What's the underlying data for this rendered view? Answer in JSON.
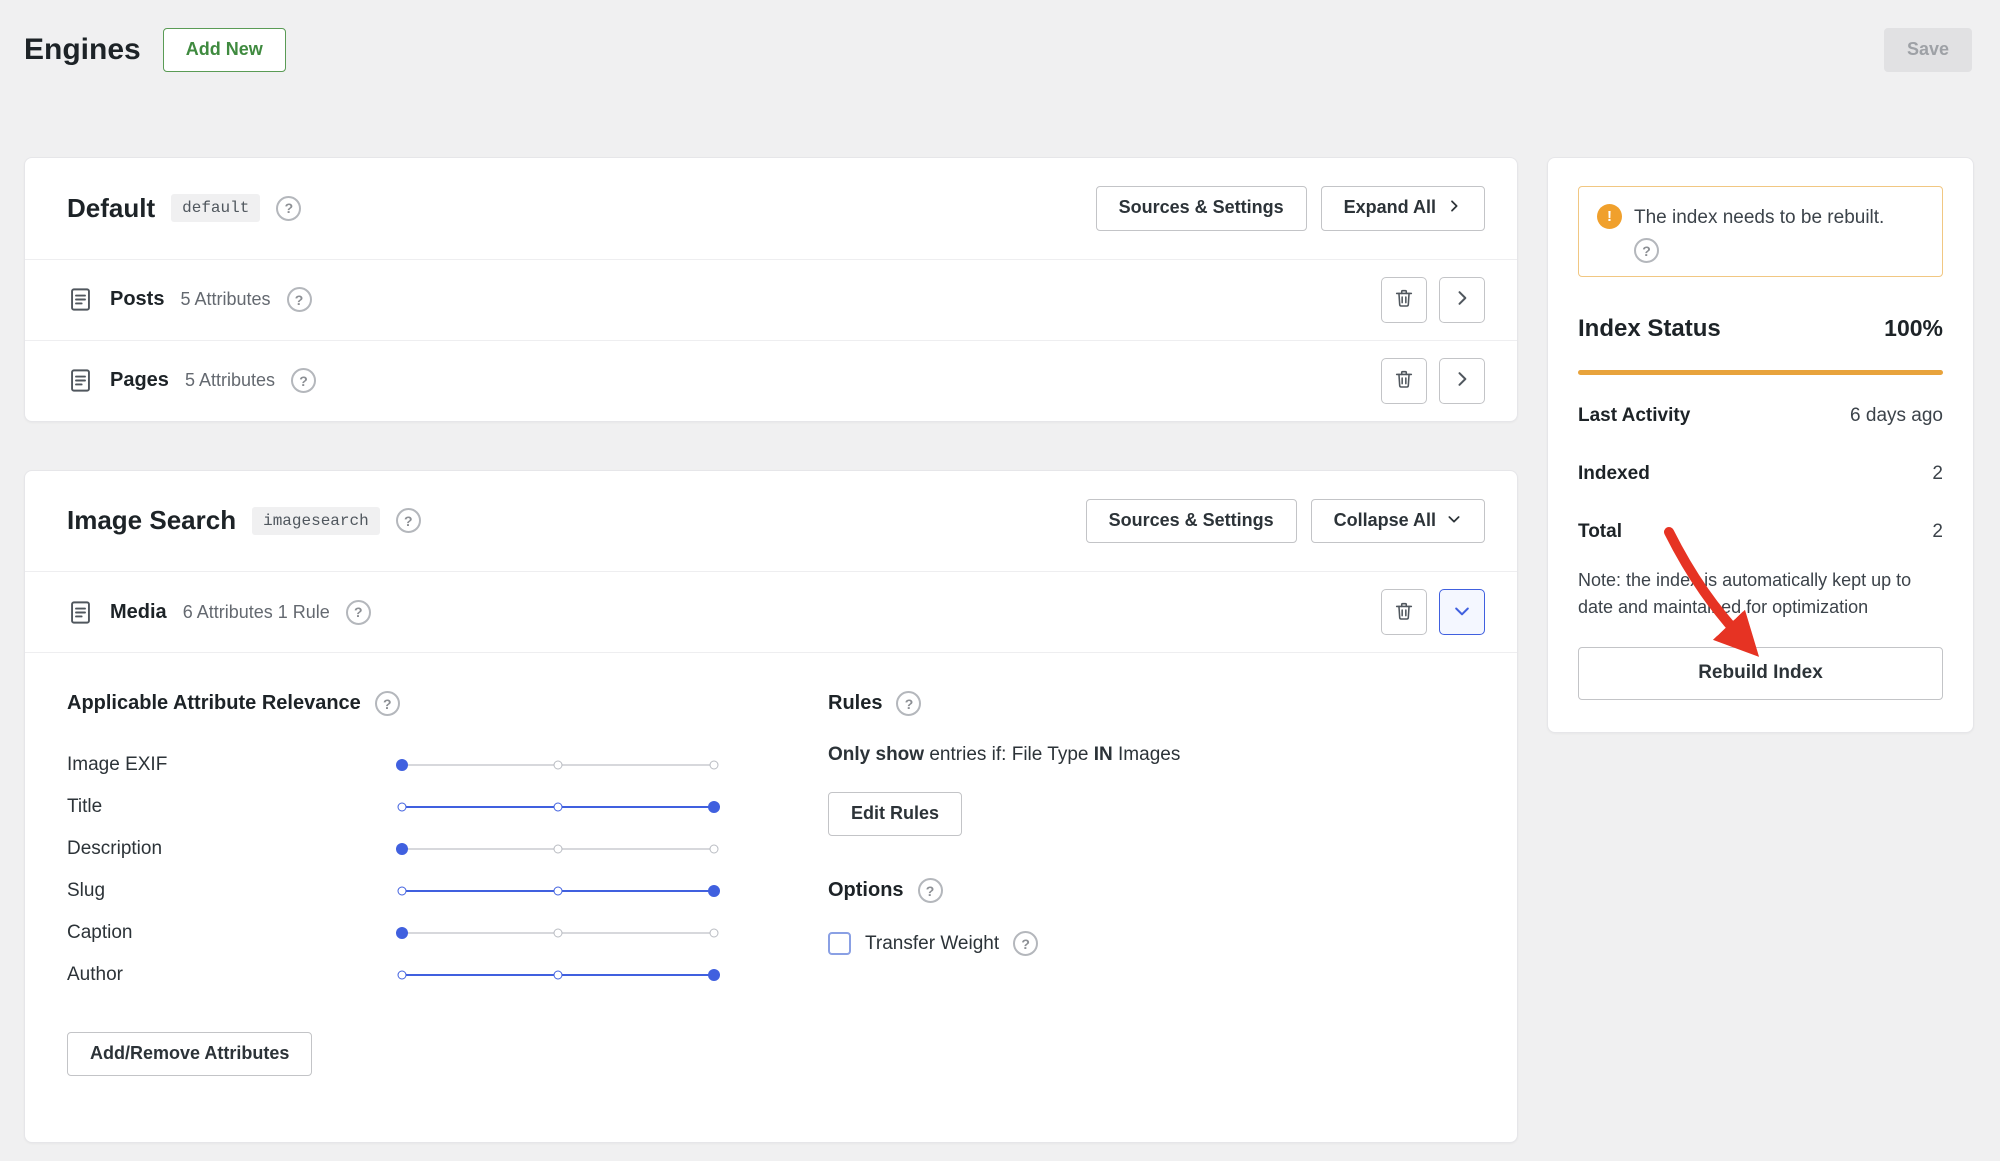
{
  "page": {
    "title": "Engines",
    "add_new_label": "Add New",
    "save_label": "Save"
  },
  "icons": {
    "help": "?",
    "alert": "!"
  },
  "engines": [
    {
      "name": "Default",
      "slug": "default",
      "sources_settings_label": "Sources & Settings",
      "toggle_label": "Expand All",
      "sources": [
        {
          "name": "Posts",
          "meta": "5 Attributes"
        },
        {
          "name": "Pages",
          "meta": "5 Attributes"
        }
      ]
    },
    {
      "name": "Image Search",
      "slug": "imagesearch",
      "sources_settings_label": "Sources & Settings",
      "toggle_label": "Collapse All",
      "sources": [
        {
          "name": "Media",
          "meta": "6 Attributes 1 Rule"
        }
      ],
      "expanded": {
        "relevance_title": "Applicable Attribute Relevance",
        "attributes": [
          {
            "label": "Image EXIF",
            "value": 0
          },
          {
            "label": "Title",
            "value": 100
          },
          {
            "label": "Description",
            "value": 0
          },
          {
            "label": "Slug",
            "value": 100
          },
          {
            "label": "Caption",
            "value": 0
          },
          {
            "label": "Author",
            "value": 100
          }
        ],
        "add_remove_label": "Add/Remove Attributes",
        "rules_title": "Rules",
        "rule": {
          "bold1": "Only show",
          "mid": " entries if: File Type ",
          "bold2": "IN",
          "end": " Images"
        },
        "edit_rules_label": "Edit Rules",
        "options_title": "Options",
        "transfer_weight_label": "Transfer Weight"
      }
    }
  ],
  "sidebar": {
    "alert_text": "The index needs to be rebuilt.",
    "status_title": "Index Status",
    "status_value": "100%",
    "stats": [
      {
        "label": "Last Activity",
        "value": "6 days ago"
      },
      {
        "label": "Indexed",
        "value": "2"
      },
      {
        "label": "Total",
        "value": "2"
      }
    ],
    "note": "Note: the index is automatically kept up to date and maintained for optimization",
    "rebuild_label": "Rebuild Index"
  },
  "colors": {
    "accent": "#4060df",
    "green": "#3f8a3f",
    "orange": "#e8a33c",
    "arrow": "#e63323"
  }
}
